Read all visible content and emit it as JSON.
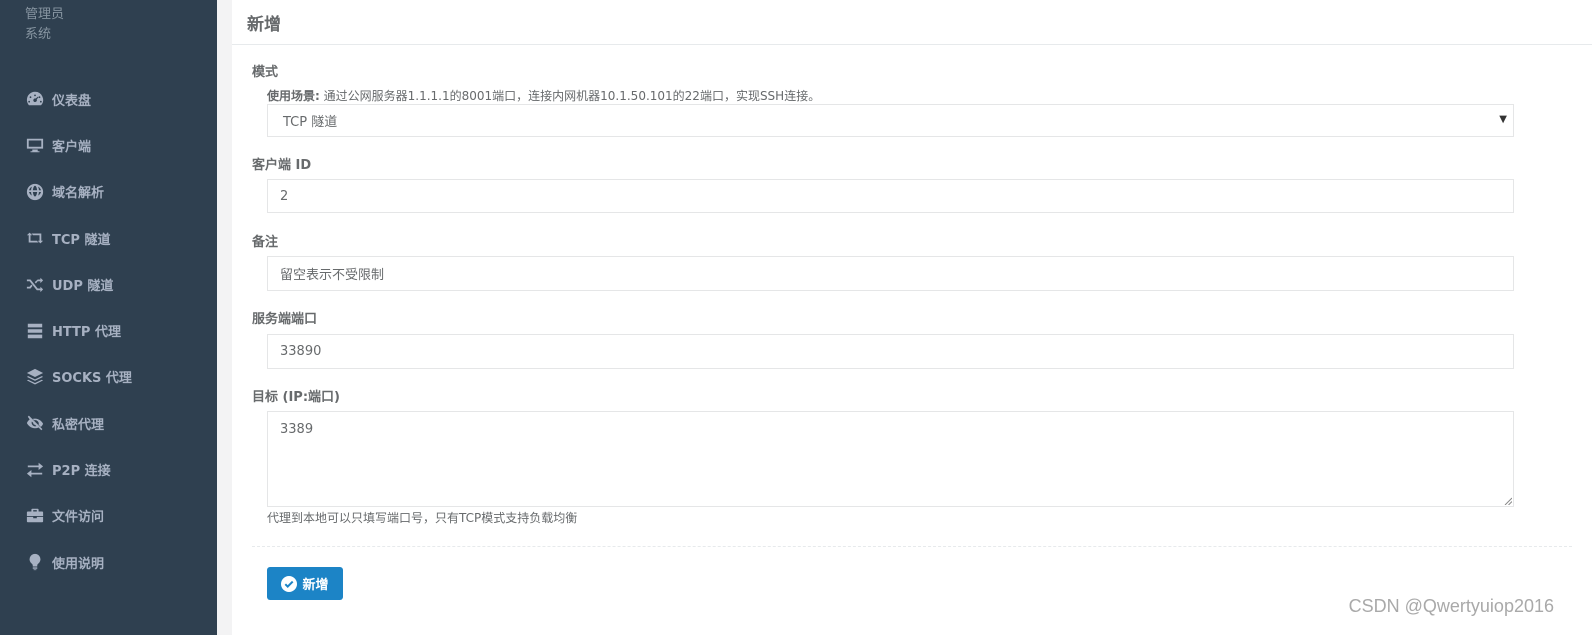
{
  "sidebar": {
    "user_role": "管理员",
    "user_dept": "系统",
    "items": [
      {
        "label": "仪表盘",
        "icon": "dashboard-icon"
      },
      {
        "label": "客户端",
        "icon": "desktop-icon"
      },
      {
        "label": "域名解析",
        "icon": "globe-icon"
      },
      {
        "label": "TCP 隧道",
        "icon": "retweet-icon"
      },
      {
        "label": "UDP 隧道",
        "icon": "random-icon"
      },
      {
        "label": "HTTP 代理",
        "icon": "server-icon"
      },
      {
        "label": "SOCKS 代理",
        "icon": "layers-icon"
      },
      {
        "label": "私密代理",
        "icon": "eye-slash-icon"
      },
      {
        "label": "P2P 连接",
        "icon": "exchange-icon"
      },
      {
        "label": "文件访问",
        "icon": "briefcase-icon"
      },
      {
        "label": "使用说明",
        "icon": "lightbulb-icon"
      }
    ]
  },
  "panel": {
    "title": "新增"
  },
  "form": {
    "mode": {
      "label": "模式",
      "scenario_label": "使用场景:",
      "scenario_text": " 通过公网服务器1.1.1.1的8001端口，连接内网机器10.1.50.101的22端口，实现SSH连接。",
      "value": "TCP 隧道"
    },
    "client_id": {
      "label": "客户端 ID",
      "value": "2"
    },
    "remark": {
      "label": "备注",
      "placeholder": "留空表示不受限制"
    },
    "server_port": {
      "label": "服务端端口",
      "value": "33890"
    },
    "target": {
      "label": "目标 (IP:端口)",
      "value": "3389",
      "help": "代理到本地可以只填写端口号，只有TCP模式支持负载均衡"
    },
    "submit_label": "新增"
  },
  "watermark": "CSDN @Qwertyuiop2016"
}
